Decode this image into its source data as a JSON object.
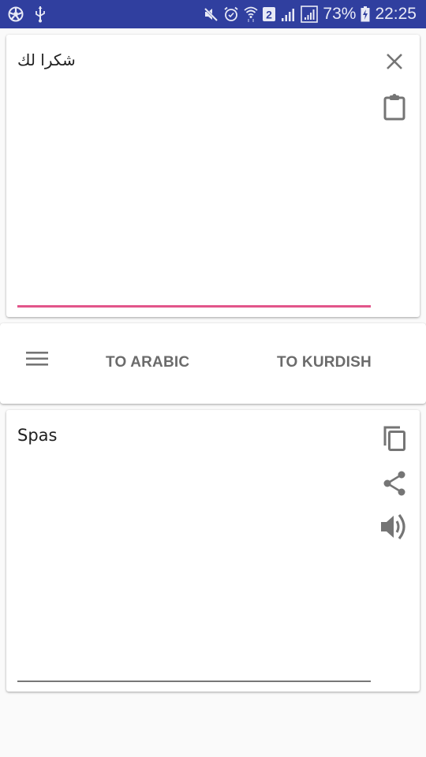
{
  "status_bar": {
    "left_icons": [
      "aperture-icon",
      "usb-icon"
    ],
    "right_icons": [
      "mute-icon",
      "alarm-icon",
      "wifi-icon",
      "sim-2-icon",
      "signal-icon",
      "signal-boxed-icon"
    ],
    "sim_label": "2",
    "battery_percent": "73%",
    "time": "22:25",
    "background_color": "#303f9f"
  },
  "input_card": {
    "text": "شكرا لك",
    "clear_icon": "close-icon",
    "paste_icon": "clipboard-icon",
    "underline_color": "#e2558a"
  },
  "toolbar": {
    "menu_icon": "menu-icon",
    "to_arabic_label": "TO ARABIC",
    "to_kurdish_label": "TO KURDISH"
  },
  "output_card": {
    "text": "Spas",
    "copy_icon": "copy-icon",
    "share_icon": "share-icon",
    "speak_icon": "volume-icon"
  }
}
